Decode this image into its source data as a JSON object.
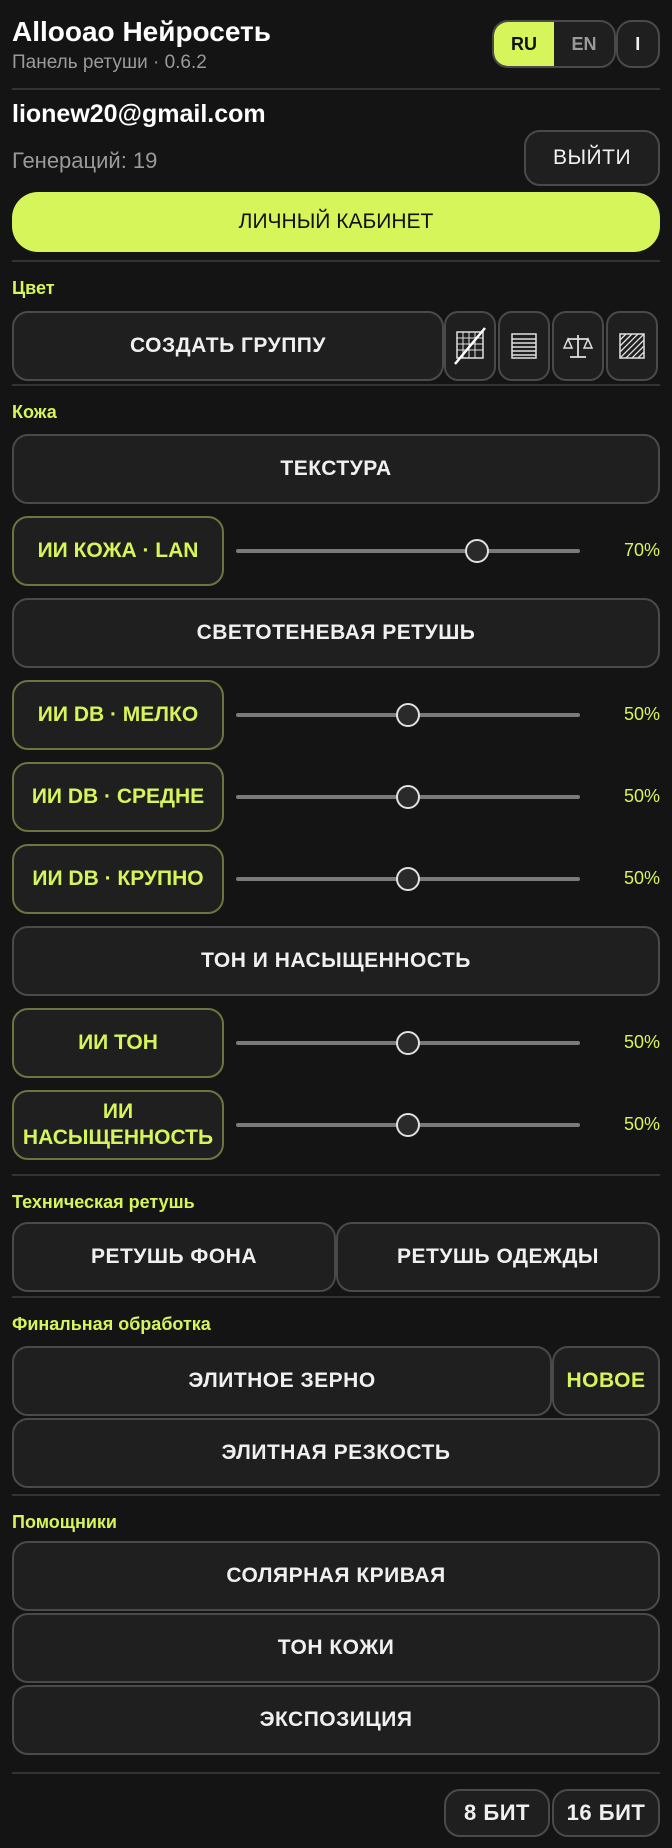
{
  "header": {
    "title": "Allooao Нейросеть",
    "subtitle": "Панель ретуши · 0.6.2",
    "lang_ru": "RU",
    "lang_en": "EN",
    "info_label": "I"
  },
  "account": {
    "email": "lionew20@gmail.com",
    "generations": "Генераций: 19",
    "logout_label": "ВЫЙТИ",
    "cabinet_label": "ЛИЧНЫЙ КАБИНЕТ"
  },
  "color_section": {
    "label": "Цвет",
    "create_group_label": "СОЗДАТЬ ГРУППУ",
    "icons": [
      "grid-off-icon",
      "stripes-icon",
      "scales-icon",
      "diagonal-hatch-icon"
    ]
  },
  "skin_section": {
    "label": "Кожа",
    "texture_label": "ТЕКСТУРА",
    "light_shadow_label": "СВЕТОТЕНЕВАЯ РЕТУШЬ",
    "tone_sat_label": "ТОН И НАСЫЩЕННОСТЬ",
    "ai_skin": {
      "label": "ИИ КОЖА · LAN",
      "value": 70,
      "value_text": "70%"
    },
    "db_fine": {
      "label": "ИИ DB · МЕЛКО",
      "value": 50,
      "value_text": "50%"
    },
    "db_medium": {
      "label": "ИИ DB · СРЕДНЕ",
      "value": 50,
      "value_text": "50%"
    },
    "db_coarse": {
      "label": "ИИ DB · КРУПНО",
      "value": 50,
      "value_text": "50%"
    },
    "ai_tone": {
      "label": "ИИ ТОН",
      "value": 50,
      "value_text": "50%"
    },
    "ai_saturation": {
      "label_line1": "ИИ",
      "label_line2": "НАСЫЩЕННОСТЬ",
      "value": 50,
      "value_text": "50%"
    }
  },
  "tech_section": {
    "label": "Техническая ретушь",
    "background_label": "РЕТУШЬ ФОНА",
    "clothes_label": "РЕТУШЬ ОДЕЖДЫ"
  },
  "final_section": {
    "label": "Финальная обработка",
    "elite_grain_label": "ЭЛИТНОЕ ЗЕРНО",
    "new_label": "НОВОЕ",
    "elite_sharpness_label": "ЭЛИТНАЯ РЕЗКОСТЬ"
  },
  "helpers_section": {
    "label": "Помощники",
    "solar_curve_label": "СОЛЯРНАЯ КРИВАЯ",
    "skin_tone_label": "ТОН КОЖИ",
    "exposure_label": "ЭКСПОЗИЦИЯ"
  },
  "footer": {
    "bit8_label": "8 БИТ",
    "bit16_label": "16 БИТ"
  },
  "colors": {
    "accent": "#d6f55a",
    "background": "#141414",
    "button_bg": "#1f1f1f",
    "border": "#4a4a4a"
  }
}
